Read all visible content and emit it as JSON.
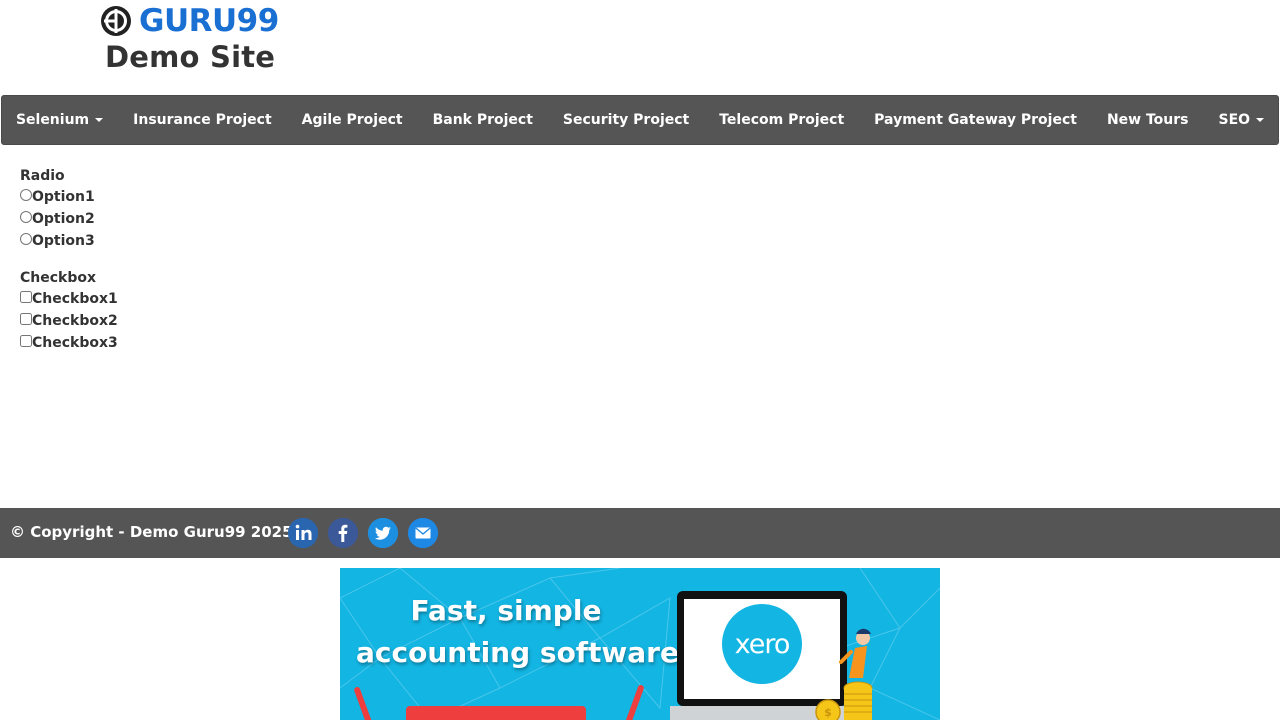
{
  "header": {
    "logo_text": "GURU99",
    "site_title": "Demo Site"
  },
  "nav": {
    "items": [
      {
        "label": "Selenium",
        "dropdown": true
      },
      {
        "label": "Insurance Project",
        "dropdown": false
      },
      {
        "label": "Agile Project",
        "dropdown": false
      },
      {
        "label": "Bank Project",
        "dropdown": false
      },
      {
        "label": "Security Project",
        "dropdown": false
      },
      {
        "label": "Telecom Project",
        "dropdown": false
      },
      {
        "label": "Payment Gateway Project",
        "dropdown": false
      },
      {
        "label": "New Tours",
        "dropdown": false
      },
      {
        "label": "SEO",
        "dropdown": true
      }
    ]
  },
  "form": {
    "radio": {
      "label": "Radio",
      "options": [
        {
          "label": "Option1",
          "checked": false
        },
        {
          "label": "Option2",
          "checked": false
        },
        {
          "label": "Option3",
          "checked": false
        }
      ]
    },
    "checkbox": {
      "label": "Checkbox",
      "options": [
        {
          "label": "Checkbox1",
          "checked": false
        },
        {
          "label": "Checkbox2",
          "checked": false
        },
        {
          "label": "Checkbox3",
          "checked": false
        }
      ]
    }
  },
  "footer": {
    "copyright": "© Copyright - Demo Guru99 2025",
    "social": [
      {
        "icon": "linkedin-icon",
        "color": "#2867b2"
      },
      {
        "icon": "facebook-icon",
        "color": "#3b5998"
      },
      {
        "icon": "twitter-icon",
        "color": "#1da1f2"
      },
      {
        "icon": "email-icon",
        "color": "#1e88e5"
      }
    ]
  },
  "ad": {
    "headline_line1": "Fast, simple",
    "headline_line2": "accounting software",
    "brand": "xero",
    "background": "#13b5e3"
  },
  "colors": {
    "nav_bg": "#555555",
    "footer_bg": "#555555",
    "logo_blue": "#1a6fd3"
  }
}
